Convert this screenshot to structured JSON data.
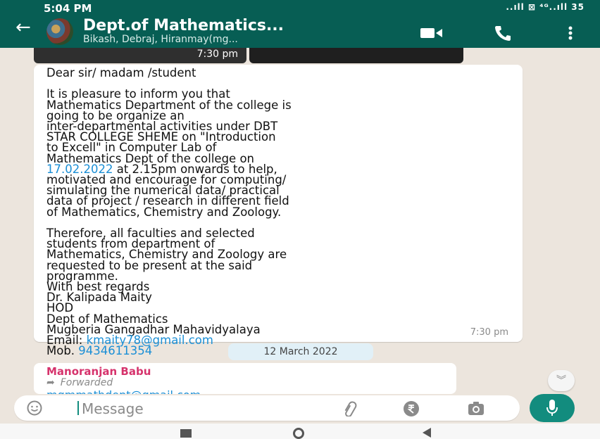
{
  "status_bar": {
    "time": "5:04 PM",
    "indicators": "..ıll ⊠ ⁴ᴳ..ıll 35"
  },
  "header": {
    "title": "Dept.of Mathematics...",
    "subtitle": "Bikash, Debraj, Hiranmay(mg...",
    "back_icon": "back-arrow-icon",
    "video_icon": "video-call-icon",
    "phone_icon": "phone-icon",
    "menu_icon": "overflow-menu-icon"
  },
  "media_strip": {
    "time": "7:30 pm"
  },
  "message": {
    "greeting": "Dear sir/ madam /student",
    "para1_before_date": "It is pleasure to inform you that\nMathematics Department of the college is\ngoing to be organize an\ninter-departmental activities  under DBT\nSTAR COLLEGE SHEME on \"Introduction\nto Excell\" in Computer Lab of\nMathematics Dept of the college on\n",
    "date_link": "17.02.2022",
    "para1_after_date": " at  2.15pm onwards to help,\nmotivated and encourage for computing/\nsimulating the numerical data/ practical\ndata of project / research in different field\nof Mathematics, Chemistry and Zoology.",
    "para2": "Therefore, all faculties and selected\nstudents from department of\nMathematics, Chemistry and Zoology are\nrequested to be present at the said\nprogramme.\nWith best regards\nDr. Kalipada Maity\nHOD\nDept of Mathematics\nMugberia Gangadhar Mahavidyalaya\nEmail: ",
    "email_link": "kmaity78@gmail.com",
    "mob_label": "\nMob. ",
    "phone_link": "9434611354",
    "time": "7:30 pm"
  },
  "date_chip": "12 March 2022",
  "message2": {
    "sender": "Manoranjan Babu",
    "forwarded_label": "Forwarded",
    "preview": "mgmmathdept@gmail.com"
  },
  "input_bar": {
    "placeholder": "Message",
    "emoji_icon": "emoji-icon",
    "attach_icon": "paperclip-icon",
    "payment_icon": "rupee-icon",
    "camera_icon": "camera-icon",
    "mic_icon": "mic-icon"
  },
  "colors": {
    "header": "#075e54",
    "accent": "#128c7e",
    "link": "#1b8fd6",
    "sender": "#d6336c",
    "chat_bg": "#ece5dd"
  }
}
